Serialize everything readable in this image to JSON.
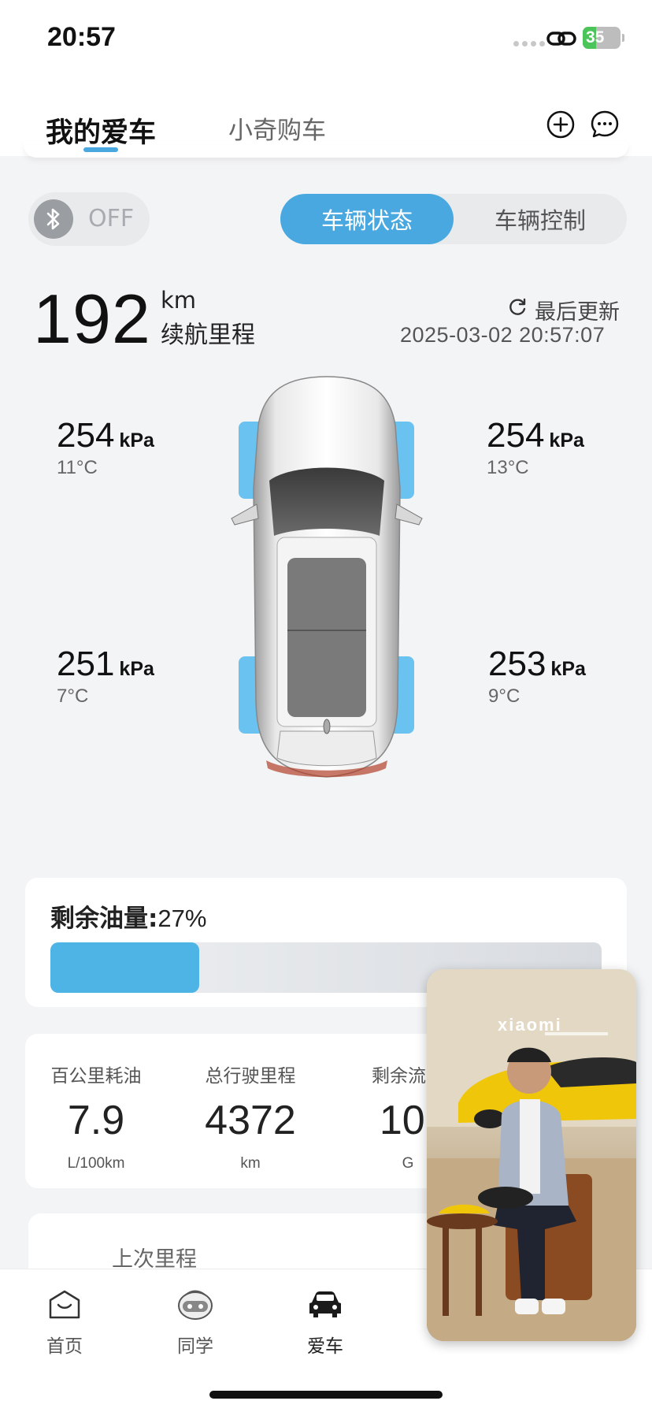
{
  "status_bar": {
    "time": "20:57",
    "battery": "35",
    "battery_level": 0.35,
    "battery_color": "#4bc45a"
  },
  "top_nav": {
    "tabs": [
      {
        "label": "我的爱车",
        "active": true
      },
      {
        "label": "小奇购车",
        "active": false
      }
    ],
    "add_icon": "plus-circle-icon",
    "message_icon": "chat-bubble-icon"
  },
  "bluetooth": {
    "icon": "bluetooth-icon",
    "state": "OFF"
  },
  "segment": {
    "active": "车辆状态",
    "inactive": "车辆控制"
  },
  "range": {
    "value": "192",
    "unit": "km",
    "label": "续航里程"
  },
  "last_update": {
    "label": "最后更新",
    "time": "2025-03-02 20:57:07"
  },
  "tires": {
    "front_left": {
      "pressure": "254",
      "unit": "kPa",
      "temp": "11°C"
    },
    "front_right": {
      "pressure": "254",
      "unit": "kPa",
      "temp": "13°C"
    },
    "rear_left": {
      "pressure": "251",
      "unit": "kPa",
      "temp": "7°C"
    },
    "rear_right": {
      "pressure": "253",
      "unit": "kPa",
      "temp": "9°C"
    }
  },
  "fuel": {
    "label": "剩余油量:",
    "value": "27%",
    "level": 0.27,
    "color": "#4eb4e6"
  },
  "stats": [
    {
      "label": "百公里耗油",
      "value": "7.9",
      "unit": "L/100km"
    },
    {
      "label": "总行驶里程",
      "value": "4372",
      "unit": "km"
    },
    {
      "label": "剩余流量",
      "value": "10.",
      "unit": "G"
    }
  ],
  "trip": {
    "label": "上次里程"
  },
  "bottom_nav": [
    {
      "label": "首页",
      "icon": "home-icon"
    },
    {
      "label": "同学",
      "icon": "mascot-icon"
    },
    {
      "label": "爱车",
      "icon": "car-icon",
      "active": true
    },
    {
      "label": "",
      "icon": "hidden-icon"
    },
    {
      "label": "",
      "icon": "hidden-icon"
    }
  ],
  "video_overlay": {
    "brand_text": "xiaomi"
  },
  "colors": {
    "accent": "#4aa8e0",
    "tire_highlight": "#5bbcf0"
  }
}
